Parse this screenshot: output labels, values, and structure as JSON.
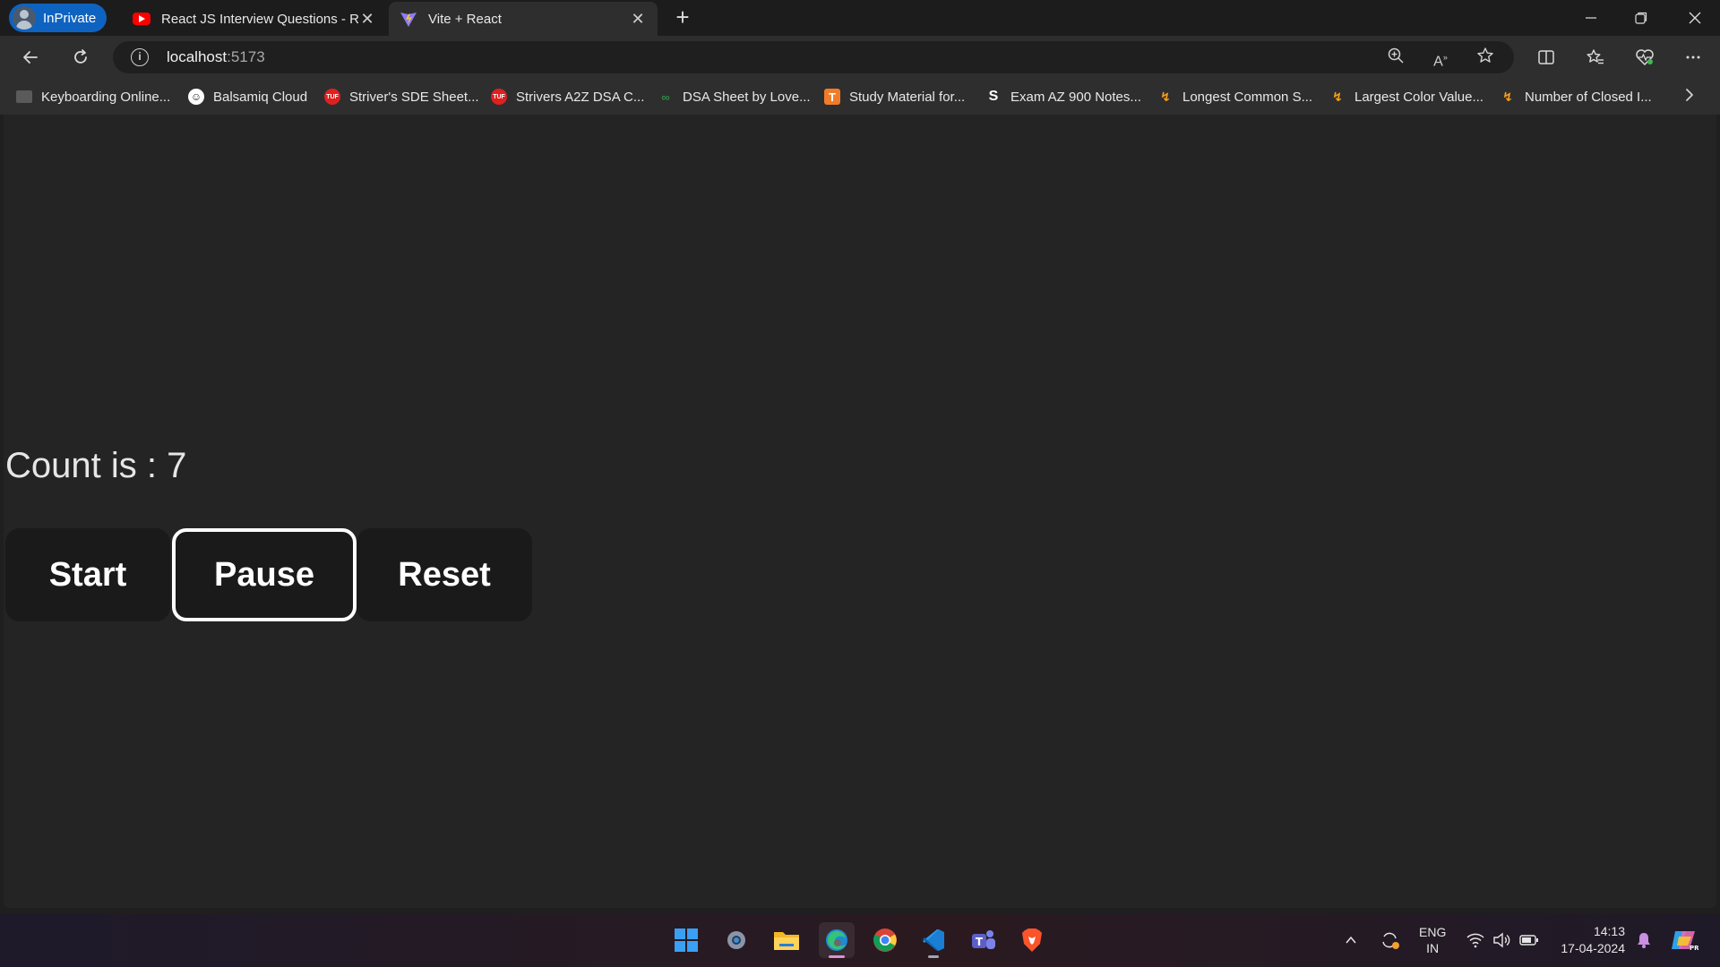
{
  "browser": {
    "inprivate_label": "InPrivate",
    "tabs": [
      {
        "title": "React JS Interview Questions - Re",
        "icon": "youtube-icon"
      },
      {
        "title": "Vite + React",
        "icon": "vite-icon"
      }
    ],
    "new_tab": "+",
    "address": {
      "host": "localhost",
      "port": ":5173"
    },
    "bookmarks": [
      {
        "label": "Keyboarding Online...",
        "icon": "keyboard-icon",
        "color": "#7a7a7a"
      },
      {
        "label": "Balsamiq Cloud",
        "icon": "balsamiq-icon",
        "color": "#ffffff"
      },
      {
        "label": "Striver's SDE Sheet...",
        "icon": "tuf-icon",
        "color": "#e02020"
      },
      {
        "label": "Strivers A2Z DSA C...",
        "icon": "tuf-icon",
        "color": "#e02020"
      },
      {
        "label": "DSA Sheet by Love...",
        "icon": "gfg-icon",
        "color": "#2f8d46"
      },
      {
        "label": "Study Material for...",
        "icon": "t-icon",
        "color": "#f07c2a"
      },
      {
        "label": "Exam AZ 900 Notes...",
        "icon": "s-icon",
        "color": "#3a3a3a"
      },
      {
        "label": "Longest Common S...",
        "icon": "leetcode-icon",
        "color": "#f89f1b"
      },
      {
        "label": "Largest Color Value...",
        "icon": "leetcode-icon",
        "color": "#f89f1b"
      },
      {
        "label": "Number of Closed I...",
        "icon": "leetcode-icon",
        "color": "#f89f1b"
      }
    ]
  },
  "app": {
    "count_text": "Count is : 7",
    "buttons": {
      "start": "Start",
      "pause": "Pause",
      "reset": "Reset"
    }
  },
  "taskbar": {
    "apps": [
      "windows-start-icon",
      "settings-icon",
      "file-explorer-icon",
      "edge-icon",
      "chrome-icon",
      "vscode-icon",
      "teams-icon",
      "brave-icon"
    ],
    "language_line1": "ENG",
    "language_line2": "IN",
    "time": "14:13",
    "date": "17-04-2024"
  }
}
